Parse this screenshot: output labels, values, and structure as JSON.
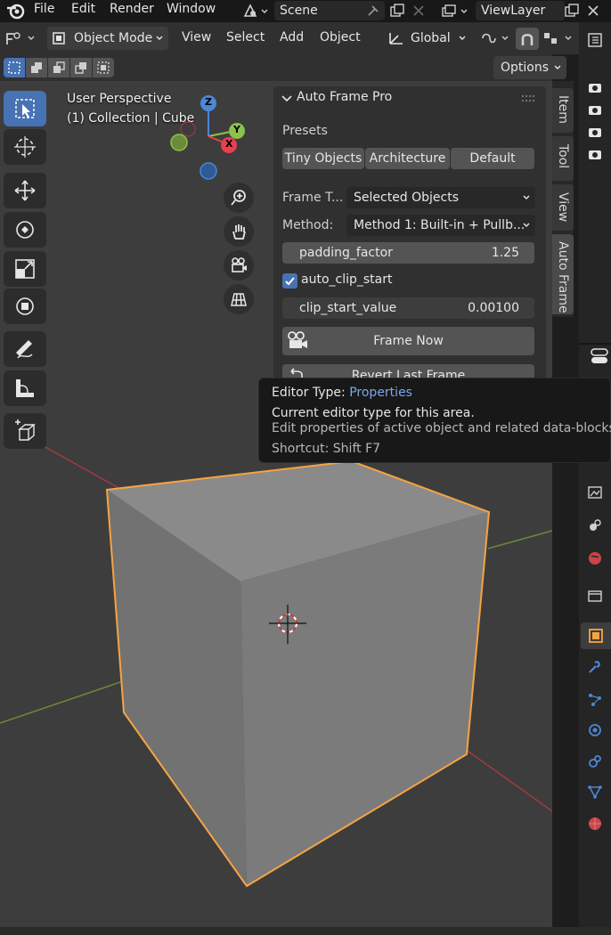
{
  "menu": {
    "items": [
      "File",
      "Edit",
      "Render",
      "Window"
    ],
    "scene": "Scene",
    "view_layer": "ViewLayer"
  },
  "header": {
    "mode": "Object Mode",
    "menus": [
      "View",
      "Select",
      "Add",
      "Object"
    ],
    "orientation": "Global",
    "options": "Options"
  },
  "viewport": {
    "perspective": "User Perspective",
    "collection": "(1) Collection | Cube",
    "gizmo_axes": [
      "Z",
      "Y",
      "X"
    ]
  },
  "panel": {
    "title": "Auto Frame Pro",
    "presets_label": "Presets",
    "presets": [
      "Tiny Objects",
      "Architecture",
      "Default"
    ],
    "frame_target_label": "Frame T...",
    "frame_target_value": "Selected Objects",
    "method_label": "Method:",
    "method_value": "Method 1: Built-in + Pullb...",
    "padding_label": "padding_factor",
    "padding_value": "1.25",
    "auto_clip_label": "auto_clip_start",
    "auto_clip_checked": true,
    "clip_label": "clip_start_value",
    "clip_value": "0.00100",
    "frame_now": "Frame Now",
    "revert": "Revert Last Frame"
  },
  "tabs": [
    "Item",
    "Tool",
    "View",
    "Auto Frame"
  ],
  "tooltip": {
    "title_prefix": "Editor Type:",
    "title_value": "Properties",
    "line1": "Current editor type for this area.",
    "line2": "Edit properties of active object and related data-blocks",
    "shortcut": "Shortcut: Shift F7"
  },
  "colors": {
    "accent": "#4772b3",
    "selection_outline": "#f5a443",
    "axis_x": "#e8404f",
    "axis_y": "#8bc34a",
    "axis_z": "#4a88d8",
    "tooltip_link": "#7aa8ea"
  }
}
